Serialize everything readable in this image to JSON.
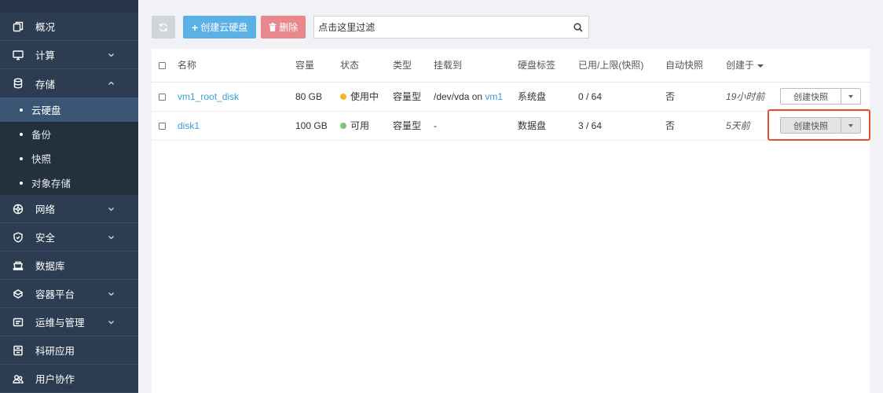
{
  "sidebar": {
    "items": [
      {
        "label": "概况",
        "icon": "overview-icon",
        "chevron": ""
      },
      {
        "label": "计算",
        "icon": "monitor-icon",
        "chevron": "down"
      },
      {
        "label": "存储",
        "icon": "storage-icon",
        "chevron": "up"
      },
      {
        "label": "网络",
        "icon": "network-icon",
        "chevron": "down"
      },
      {
        "label": "安全",
        "icon": "shield-icon",
        "chevron": "down"
      },
      {
        "label": "数据库",
        "icon": "database-icon",
        "chevron": ""
      },
      {
        "label": "容器平台",
        "icon": "container-icon",
        "chevron": "down"
      },
      {
        "label": "运维与管理",
        "icon": "ops-icon",
        "chevron": "down"
      },
      {
        "label": "科研应用",
        "icon": "research-icon",
        "chevron": ""
      },
      {
        "label": "用户协作",
        "icon": "users-icon",
        "chevron": ""
      }
    ],
    "storage_sub": [
      "云硬盘",
      "备份",
      "快照",
      "对象存储"
    ],
    "active_sub": "云硬盘"
  },
  "toolbar": {
    "create_label": "创建云硬盘",
    "delete_label": "删除",
    "search_placeholder": "点击这里过滤"
  },
  "table": {
    "columns": [
      "名称",
      "容量",
      "状态",
      "类型",
      "挂载到",
      "硬盘标签",
      "已用/上限(快照)",
      "自动快照",
      "创建于"
    ],
    "rows": [
      {
        "name": "vm1_root_disk",
        "capacity": "80 GB",
        "status": "使用中",
        "status_color": "#f0b52a",
        "type": "容量型",
        "mount_prefix": "/dev/vda on ",
        "mount_link": "vm1",
        "tag": "系统盘",
        "used": "0 / 64",
        "auto_snapshot": "否",
        "created": "19小时前",
        "action": "创建快照"
      },
      {
        "name": "disk1",
        "capacity": "100 GB",
        "status": "可用",
        "status_color": "#7cc47f",
        "type": "容量型",
        "mount_prefix": "-",
        "mount_link": "",
        "tag": "数据盘",
        "used": "3 / 64",
        "auto_snapshot": "否",
        "created": "5天前",
        "action": "创建快照"
      }
    ]
  },
  "colors": {
    "sidebar_bg": "#2c3d52",
    "active_item": "#3b5674",
    "primary": "#5bb0e6",
    "danger": "#e8888c",
    "link": "#3a9ddb",
    "highlight": "#e5502b"
  }
}
